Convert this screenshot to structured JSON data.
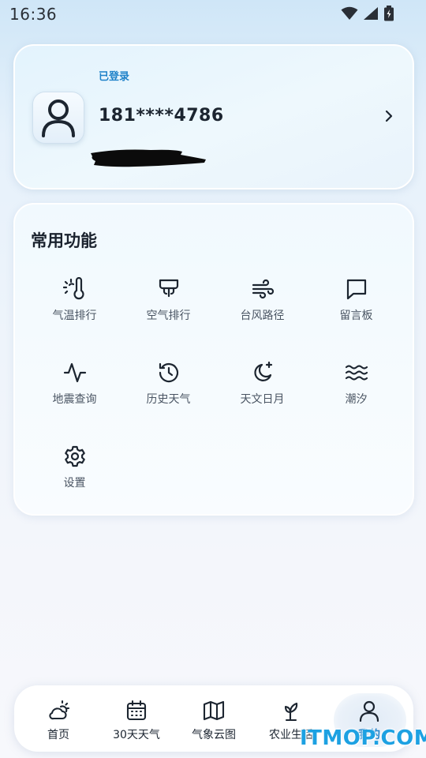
{
  "status_bar": {
    "time": "16:36"
  },
  "profile": {
    "login_status": "已登录",
    "phone": "181****4786"
  },
  "functions": {
    "title": "常用功能",
    "items": [
      {
        "label": "气温排行",
        "icon": "thermometer-icon"
      },
      {
        "label": "空气排行",
        "icon": "air-conditioner-icon"
      },
      {
        "label": "台风路径",
        "icon": "wind-icon"
      },
      {
        "label": "留言板",
        "icon": "message-square-icon"
      },
      {
        "label": "地震查询",
        "icon": "activity-pulse-icon"
      },
      {
        "label": "历史天气",
        "icon": "history-clock-icon"
      },
      {
        "label": "天文日月",
        "icon": "moon-star-icon"
      },
      {
        "label": "潮汐",
        "icon": "waves-icon"
      },
      {
        "label": "设置",
        "icon": "gear-icon"
      }
    ]
  },
  "bottom_nav": {
    "items": [
      {
        "label": "首页",
        "icon": "cloud-sun-icon"
      },
      {
        "label": "30天天气",
        "icon": "calendar-icon"
      },
      {
        "label": "气象云图",
        "icon": "map-icon"
      },
      {
        "label": "农业生活",
        "icon": "sprout-icon"
      },
      {
        "label": "我的",
        "icon": "user-icon",
        "active": true
      }
    ]
  },
  "colors": {
    "accent": "#1f82c9",
    "watermark": "#1da1e2"
  },
  "watermark": "ITMOP.COM"
}
